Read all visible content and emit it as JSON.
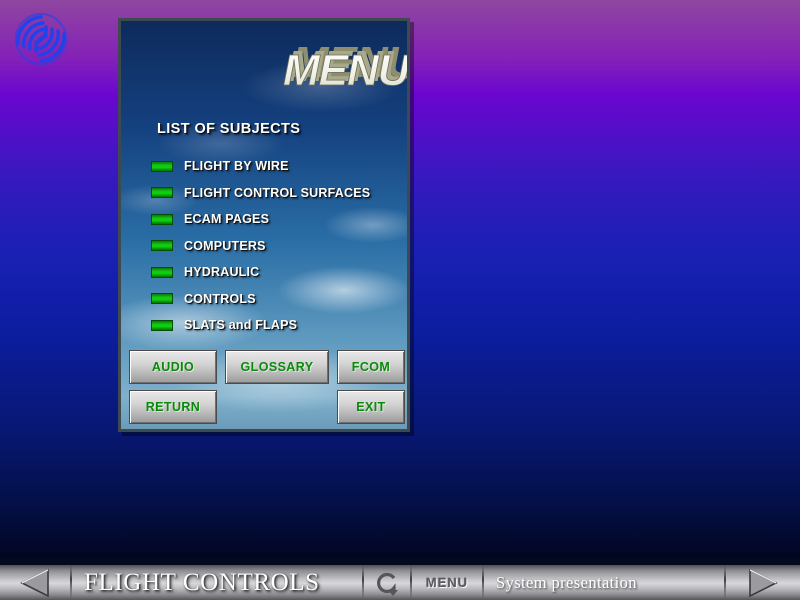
{
  "app": {
    "background_top_color": "#8f46a0",
    "background_mid_color": "#1a20b4",
    "background_bottom_color": "#010620"
  },
  "logo": {
    "name": "airbus-swirl-logo",
    "color": "#2040e8"
  },
  "panel": {
    "title": "MENU",
    "heading": "LIST OF SUBJECTS",
    "subjects": [
      {
        "label": "FLIGHT BY WIRE"
      },
      {
        "label": "FLIGHT CONTROL SURFACES"
      },
      {
        "label": "ECAM PAGES"
      },
      {
        "label": "COMPUTERS"
      },
      {
        "label": "HYDRAULIC"
      },
      {
        "label": "CONTROLS"
      },
      {
        "label": "SLATS and FLAPS"
      }
    ],
    "bullet_color": "#0bd60b",
    "buttons": {
      "audio": "AUDIO",
      "glossary": "GLOSSARY",
      "fcom": "FCOM",
      "return": "RETURN",
      "exit": "EXIT"
    },
    "button_text_color": "#0a8a0a"
  },
  "bottom_bar": {
    "prev_icon": "triangle-left-icon",
    "title": "FLIGHT CONTROLS",
    "refresh_icon": "refresh-arrow-icon",
    "menu_button": "MENU",
    "status": "System presentation",
    "next_icon": "triangle-right-icon"
  }
}
